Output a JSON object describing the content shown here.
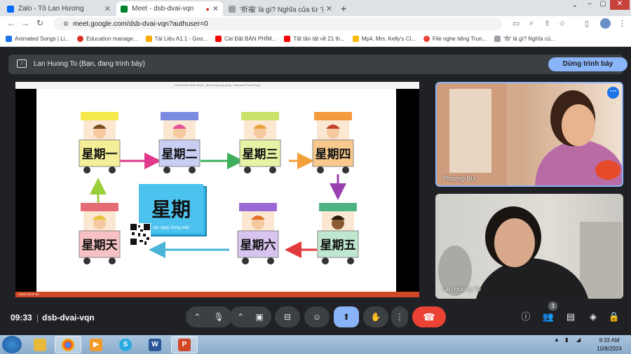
{
  "browser": {
    "tabs": [
      {
        "title": "Zalo - Tô Lan Hương",
        "icon": "zalo-icon",
        "color": "#0068ff"
      },
      {
        "title": "Meet - dsb-dvai-vqn",
        "icon": "meet-icon",
        "color": "#00832d"
      },
      {
        "title": "'祈福' là gì? Nghĩa của từ '祈福'",
        "icon": "dictionary-icon",
        "color": "#5f6368"
      }
    ],
    "url": "meet.google.com/dsb-dvai-vqn?authuser=0"
  },
  "bookmarks": [
    {
      "label": "Animated Songs | Li...",
      "color": "#1a73e8"
    },
    {
      "label": "Education manage...",
      "color": "#d93025"
    },
    {
      "label": "Tài Liệu A1.1 - Goo...",
      "color": "#f9ab00"
    },
    {
      "label": "Cài Đặt BÀN PHÍM...",
      "color": "#ff0000"
    },
    {
      "label": "Tất tần tật về 21 th...",
      "color": "#ff0000"
    },
    {
      "label": "Mp4. Mrs. Kelly's Cl...",
      "color": "#fbbc04"
    },
    {
      "label": "File nghe tiếng Trun...",
      "color": "#ea4335"
    },
    {
      "label": "'你' là gì? Nghĩa củ...",
      "color": "#5f6368"
    }
  ],
  "meet": {
    "presenting_label": "Lan Huong To (Bạn, đang trình bày)",
    "stop_presenting": "Dừng trình bày",
    "time": "09:33",
    "separator": "|",
    "meeting_code": "dsb-dvai-vqn",
    "participants_count": "3",
    "participants": [
      {
        "name": "Phuong Bui"
      },
      {
        "name": "Lan Huong To"
      }
    ]
  },
  "slide": {
    "window_title": "PowerPoint Slide Show - [thu trong tuan.pptx] - Microsoft PowerPoint",
    "center_title": "星期",
    "center_subtitle": "các ngày trong tuần",
    "days": {
      "mon": "星期一",
      "tue": "星期二",
      "wed": "星期三",
      "thu": "星期四",
      "fri": "星期五",
      "sat": "星期六",
      "sun": "星期天"
    },
    "status": "SLIDE 35 OF 56"
  },
  "taskbar": {
    "time": "9:33 AM",
    "date": "10/8/2024"
  }
}
